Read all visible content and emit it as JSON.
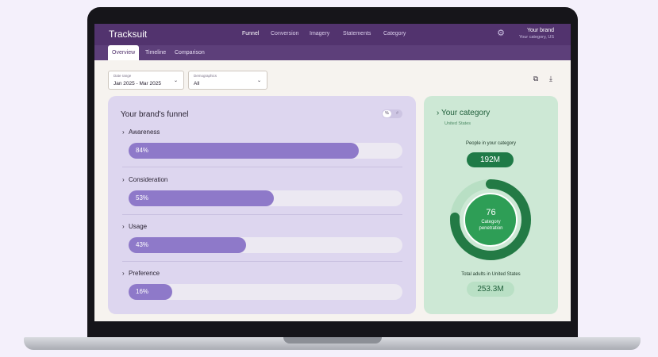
{
  "header": {
    "logo": "Tracksuit",
    "nav": [
      "Funnel",
      "Conversion",
      "Imagery",
      "Statements",
      "Category"
    ],
    "active_nav": "Funnel",
    "brand_name": "Your brand",
    "brand_sub": "Your category, US",
    "settings_icon": "gear-icon"
  },
  "tabs": [
    "Overview",
    "Timeline",
    "Comparison"
  ],
  "active_tab": "Overview",
  "filters": {
    "date_range": {
      "label": "Date range",
      "value": "Jan 2025 - Mar 2025"
    },
    "demographics": {
      "label": "Demographics",
      "value": "All"
    }
  },
  "toolbar": {
    "copy_icon": "copy-icon",
    "download_icon": "download-icon"
  },
  "funnel": {
    "title": "Your brand's funnel",
    "toggle": {
      "on": "%",
      "off": "#"
    },
    "stages": [
      {
        "label": "Awareness",
        "percent": 84,
        "display": "84%"
      },
      {
        "label": "Consideration",
        "percent": 53,
        "display": "53%"
      },
      {
        "label": "Usage",
        "percent": 43,
        "display": "43%"
      },
      {
        "label": "Preference",
        "percent": 16,
        "display": "16%"
      }
    ]
  },
  "category": {
    "title": "Your category",
    "subtitle": "United States",
    "people_label": "People in your category",
    "people_value": "192M",
    "penetration_value": "76",
    "penetration_percent": 76,
    "penetration_label": "Category penetration",
    "total_label": "Total adults in United States",
    "total_value": "253.3M"
  },
  "colors": {
    "header": "#52336e",
    "funnel_bar": "#8e79c9",
    "category_dark": "#1f7a47",
    "category_light": "#cde8d5"
  }
}
